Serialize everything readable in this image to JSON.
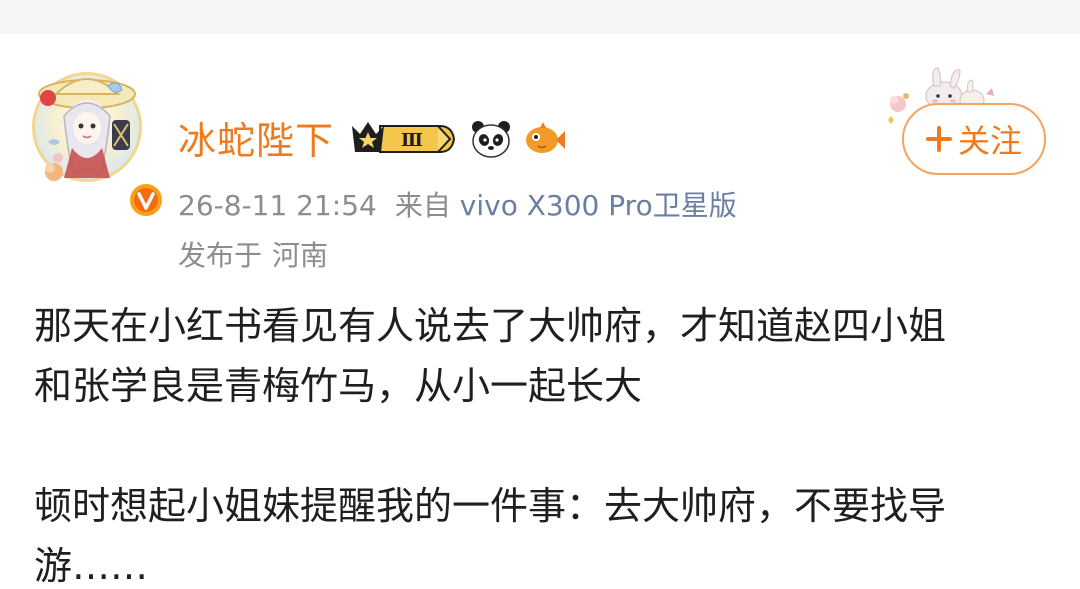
{
  "user": {
    "name": "冰蛇陛下",
    "level_badge": "Ⅲ",
    "avatar_icon": "anime-avatar",
    "verified_icon": "verified-v-icon",
    "badge_icons": [
      "crown-level-icon",
      "panda-icon",
      "fish-icon"
    ]
  },
  "post_meta": {
    "timestamp": "26-8-11 21:54",
    "source_prefix": "来自",
    "device": "vivo X300 Pro卫星版",
    "location_prefix": "发布于",
    "location": "河南"
  },
  "follow": {
    "label": "关注",
    "icon": "plus-icon"
  },
  "post_body": {
    "para1_line1": "那天在小红书看见有人说去了大帅府，才知道赵四小姐",
    "para1_line2": "和张学良是青梅竹马，从小一起长大",
    "para2_line1": "顿时想起小姐妹提醒我的一件事：去大帅府，不要找导",
    "para2_line2": "游……"
  },
  "colors": {
    "username": "#f07a1c",
    "meta": "#8d8d8d",
    "device": "#6b7fa3",
    "body_text": "#1f1f1f",
    "follow_border": "#f3a45e"
  }
}
